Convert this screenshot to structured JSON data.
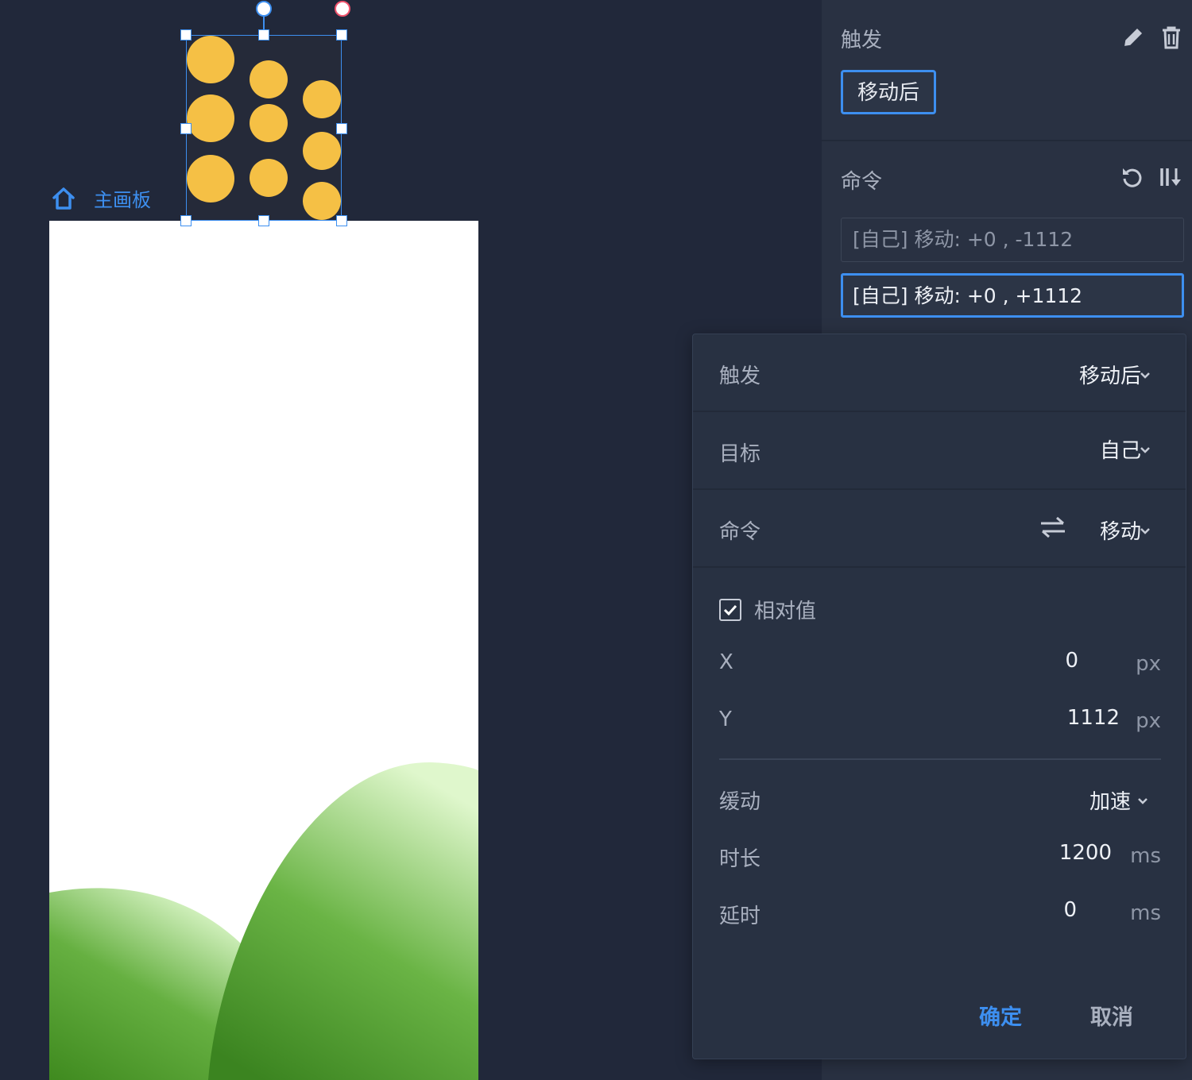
{
  "canvas": {
    "artboard_label": "主画板",
    "icons": {
      "home": "home-icon"
    }
  },
  "side_panel": {
    "trigger": {
      "title": "触发",
      "chip": "移动后",
      "icons": [
        "pencil-icon",
        "trash-icon"
      ]
    },
    "commands": {
      "title": "命令",
      "icons": [
        "undo-icon",
        "sort-icon"
      ],
      "items": [
        {
          "text": "[自己] 移动: +0 , -1112",
          "active": false
        },
        {
          "text": "[自己] 移动: +0 , +1112",
          "active": true
        }
      ]
    }
  },
  "popup": {
    "trigger": {
      "label": "触发",
      "value": "移动后"
    },
    "target": {
      "label": "目标",
      "value": "自己"
    },
    "command": {
      "label": "命令",
      "value": "移动"
    },
    "relative": {
      "label": "相对值",
      "checked": true
    },
    "x": {
      "label": "X",
      "value": "0",
      "unit": "px"
    },
    "y": {
      "label": "Y",
      "value": "1112",
      "unit": "px"
    },
    "easing": {
      "label": "缓动",
      "value": "加速"
    },
    "duration": {
      "label": "时长",
      "value": "1200",
      "unit": "ms"
    },
    "delay": {
      "label": "延时",
      "value": "0",
      "unit": "ms"
    },
    "confirm_label": "确定",
    "cancel_label": "取消"
  },
  "colors": {
    "accent": "#3d8ff0",
    "background": "#21283a",
    "panel": "#293142",
    "dot": "#f5c045",
    "hill_dark": "#3f8a1f",
    "hill_light": "#d9f5c6"
  }
}
